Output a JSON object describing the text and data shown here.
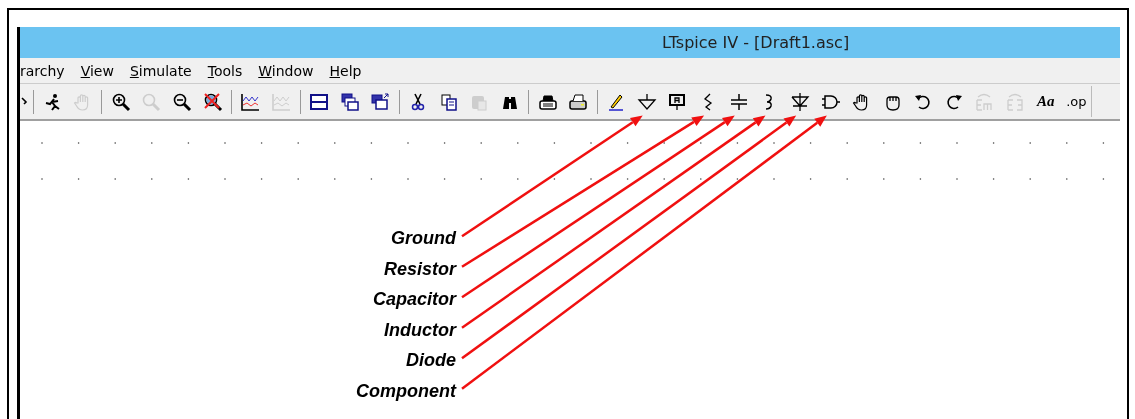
{
  "window": {
    "title": "LTspice IV - [Draft1.asc]"
  },
  "menu": [
    {
      "label": "rarchy"
    },
    {
      "key": "V",
      "rest": "iew"
    },
    {
      "key": "S",
      "rest": "imulate"
    },
    {
      "key": "T",
      "rest": "ools"
    },
    {
      "key": "W",
      "rest": "indow"
    },
    {
      "key": "H",
      "rest": "elp"
    }
  ],
  "toolbar": [
    {
      "kind": "clipped",
      "disabled": false
    },
    {
      "kind": "separator"
    },
    {
      "kind": "run",
      "disabled": false
    },
    {
      "kind": "pan",
      "disabled": true
    },
    {
      "kind": "separator"
    },
    {
      "kind": "zoom-in",
      "disabled": false
    },
    {
      "kind": "zoom-fit",
      "disabled": true
    },
    {
      "kind": "zoom-out",
      "disabled": false
    },
    {
      "kind": "zoom-cancel",
      "disabled": false
    },
    {
      "kind": "separator"
    },
    {
      "kind": "waveform",
      "disabled": false
    },
    {
      "kind": "waveform",
      "disabled": true
    },
    {
      "kind": "separator"
    },
    {
      "kind": "tile-h",
      "disabled": false
    },
    {
      "kind": "cascade",
      "disabled": false
    },
    {
      "kind": "tile",
      "disabled": false
    },
    {
      "kind": "separator"
    },
    {
      "kind": "cut",
      "disabled": false
    },
    {
      "kind": "copy",
      "disabled": false
    },
    {
      "kind": "paste",
      "disabled": true
    },
    {
      "kind": "find",
      "disabled": false
    },
    {
      "kind": "separator"
    },
    {
      "kind": "preview",
      "disabled": false
    },
    {
      "kind": "print",
      "disabled": false
    },
    {
      "kind": "separator"
    },
    {
      "kind": "wire",
      "disabled": false
    },
    {
      "kind": "ground",
      "disabled": false,
      "callout": "Ground"
    },
    {
      "kind": "label",
      "disabled": false
    },
    {
      "kind": "resistor",
      "disabled": false,
      "callout": "Resistor"
    },
    {
      "kind": "capacitor",
      "disabled": false,
      "callout": "Capacitor"
    },
    {
      "kind": "inductor",
      "disabled": false,
      "callout": "Inductor"
    },
    {
      "kind": "diode",
      "disabled": false,
      "callout": "Diode"
    },
    {
      "kind": "component",
      "disabled": false,
      "callout": "Component"
    },
    {
      "kind": "move",
      "disabled": false
    },
    {
      "kind": "drag",
      "disabled": false
    },
    {
      "kind": "undo",
      "disabled": false
    },
    {
      "kind": "redo",
      "disabled": false
    },
    {
      "kind": "rotate",
      "disabled": true
    },
    {
      "kind": "mirror",
      "disabled": true
    },
    {
      "kind": "text",
      "label": "Aa",
      "disabled": false
    },
    {
      "kind": "text",
      "label": ".op",
      "disabled": false
    }
  ]
}
